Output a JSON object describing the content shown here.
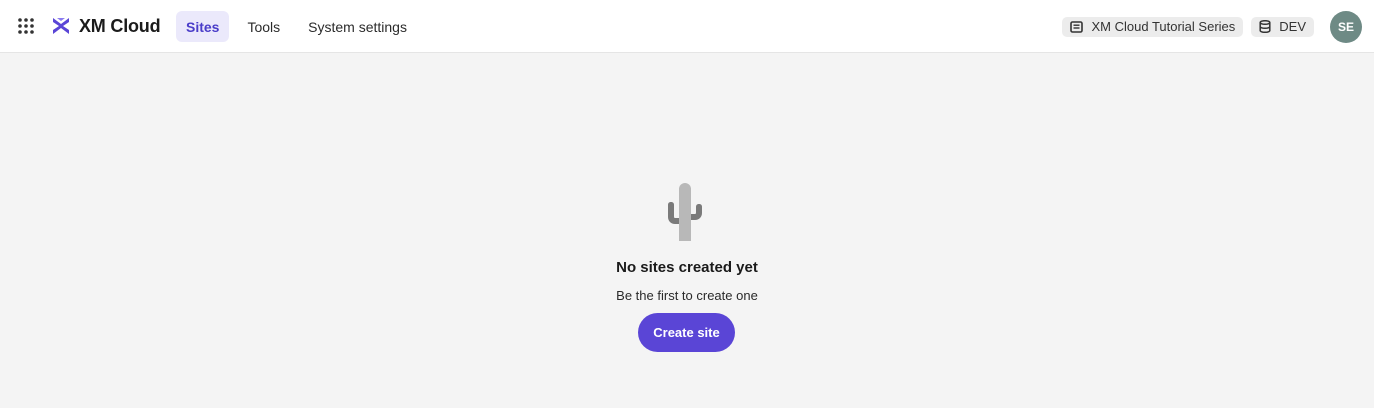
{
  "header": {
    "apps_icon": "grid-dots-icon",
    "logo_icon": "xm-cloud-logo-icon",
    "app_title": "XM Cloud",
    "tabs": [
      {
        "label": "Sites",
        "active": true
      },
      {
        "label": "Tools",
        "active": false
      },
      {
        "label": "System settings",
        "active": false
      }
    ],
    "project_chip": {
      "icon": "project-icon",
      "label": "XM Cloud Tutorial Series"
    },
    "environment_chip": {
      "icon": "database-icon",
      "label": "DEV"
    },
    "avatar_initials": "SE"
  },
  "empty_state": {
    "illustration": "cactus-icon",
    "title": "No sites created yet",
    "subtitle": "Be the first to create one",
    "button_label": "Create site"
  },
  "colors": {
    "accent": "#5a45d6",
    "active_tab_bg": "#ebe9fb",
    "active_tab_text": "#4a3dc9",
    "page_bg": "#f4f4f4",
    "avatar_bg": "#6e8a85"
  }
}
